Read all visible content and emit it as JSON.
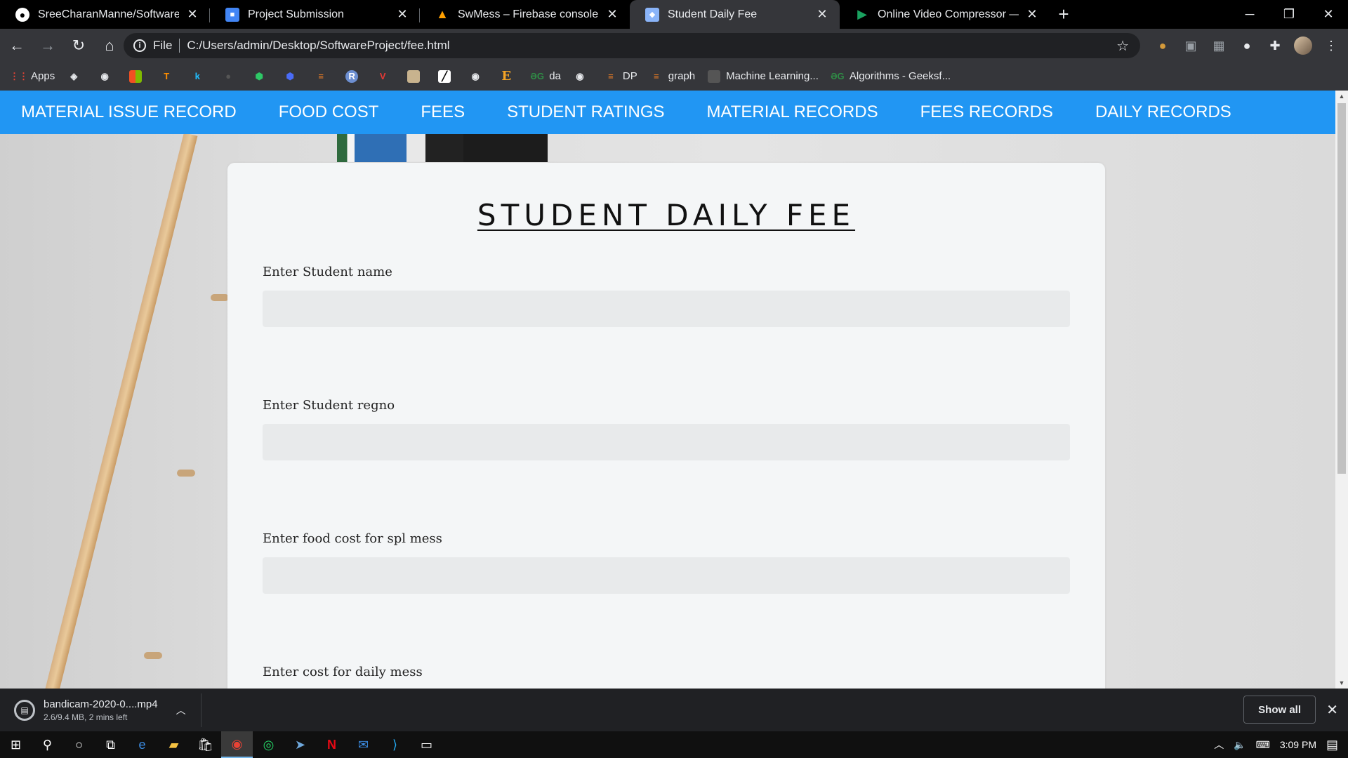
{
  "browser": {
    "tabs": [
      {
        "title": "SreeCharanManne/SoftwareProje",
        "icon": "github-icon",
        "icon_color": "#ffffff",
        "active": false
      },
      {
        "title": "Project Submission",
        "icon": "classroom-icon",
        "icon_color": "#4285f4",
        "active": false
      },
      {
        "title": "SwMess – Firebase console",
        "icon": "firebase-icon",
        "icon_color": "#ffa000",
        "active": false
      },
      {
        "title": "Student Daily Fee",
        "icon": "page-icon",
        "icon_color": "#8ab4f8",
        "active": true
      },
      {
        "title": "Online Video Compressor — Red",
        "icon": "play-icon",
        "icon_color": "#1aa260",
        "active": false
      }
    ],
    "url_scheme": "File",
    "url": "C:/Users/admin/Desktop/SoftwareProject/fee.html",
    "bookmarks": [
      {
        "label": "Apps",
        "icon": "apps-grid-icon"
      },
      {
        "label": "",
        "icon": "bookmark-icon"
      },
      {
        "label": "",
        "icon": "globe-icon"
      },
      {
        "label": "",
        "icon": "microsoft-icon"
      },
      {
        "label": "",
        "icon": "tensorflow-icon"
      },
      {
        "label": "",
        "icon": "k-icon"
      },
      {
        "label": "",
        "icon": "github-icon"
      },
      {
        "label": "",
        "icon": "hackerrank-icon"
      },
      {
        "label": "",
        "icon": "cube-icon"
      },
      {
        "label": "",
        "icon": "stackoverflow-icon"
      },
      {
        "label": "",
        "icon": "r-icon"
      },
      {
        "label": "",
        "icon": "v-icon"
      },
      {
        "label": "",
        "icon": "image-icon"
      },
      {
        "label": "",
        "icon": "chart-icon"
      },
      {
        "label": "",
        "icon": "globe-icon"
      },
      {
        "label": "",
        "icon": "e-icon"
      },
      {
        "label": "da",
        "icon": "geeksforgeeks-icon"
      },
      {
        "label": "",
        "icon": "globe-icon"
      },
      {
        "label": "DP",
        "icon": "stackoverflow-icon"
      },
      {
        "label": "graph",
        "icon": "stackoverflow-icon"
      },
      {
        "label": "Machine Learning...",
        "icon": "ml-icon"
      },
      {
        "label": "Algorithms - Geeksf...",
        "icon": "geeksforgeeks-icon"
      }
    ]
  },
  "page": {
    "nav": [
      "MATERIAL ISSUE RECORD",
      "FOOD COST",
      "FEES",
      "STUDENT RATINGS",
      "MATERIAL RECORDS",
      "FEES RECORDS",
      "DAILY RECORDS"
    ],
    "title": "STUDENT DAILY FEE",
    "fields": [
      {
        "label": "Enter Student name",
        "value": ""
      },
      {
        "label": "Enter Student regno",
        "value": ""
      },
      {
        "label": "Enter food cost for spl mess",
        "value": ""
      },
      {
        "label": "Enter cost for daily mess",
        "value": ""
      }
    ],
    "accent_color": "#2196f3"
  },
  "download": {
    "filename": "bandicam-2020-0....mp4",
    "status": "2.6/9.4 MB, 2 mins left",
    "show_all": "Show all"
  },
  "taskbar": {
    "time": "3:09 PM"
  }
}
